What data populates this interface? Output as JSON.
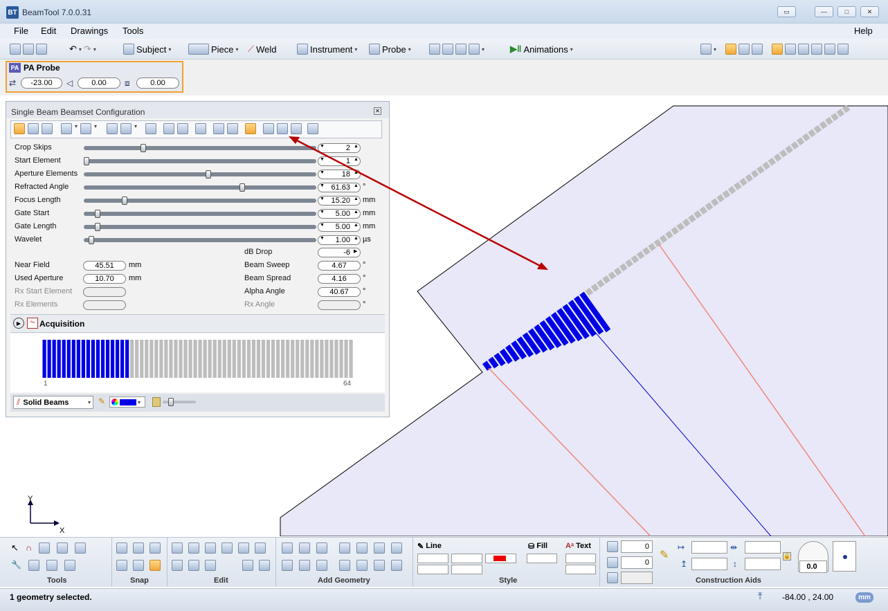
{
  "app": {
    "title": "BeamTool 7.0.0.31",
    "logo": "BT",
    "window_buttons": [
      "restore-icon",
      "minimize-icon",
      "maximize-icon",
      "close-icon"
    ]
  },
  "menu": {
    "file": "File",
    "edit": "Edit",
    "drawings": "Drawings",
    "tools": "Tools",
    "help": "Help"
  },
  "toolbar": {
    "subject": "Subject",
    "piece": "Piece",
    "weld": "Weld",
    "instrument": "Instrument",
    "probe": "Probe",
    "animations": "Animations"
  },
  "probe": {
    "badge": "PA",
    "name": "PA Probe",
    "fields": [
      {
        "icon": "offset-icon",
        "value": "-23.00"
      },
      {
        "icon": "skew-icon",
        "value": "0.00"
      },
      {
        "icon": "index-icon",
        "value": "0.00"
      }
    ]
  },
  "panel": {
    "title": "Single Beam Beamset Configuration",
    "sliders": [
      {
        "label": "Crop Skips",
        "value": "2",
        "unit": "",
        "pos": 0.25
      },
      {
        "label": "Start Element",
        "value": "1",
        "unit": "",
        "pos": 0.0
      },
      {
        "label": "Aperture Elements",
        "value": "18",
        "unit": "",
        "pos": 0.54
      },
      {
        "label": "Refracted Angle",
        "value": "61.63",
        "unit": "°",
        "pos": 0.69
      },
      {
        "label": "Focus Length",
        "value": "15.20",
        "unit": "mm",
        "pos": 0.17
      },
      {
        "label": "Gate Start",
        "value": "5.00",
        "unit": "mm",
        "pos": 0.05
      },
      {
        "label": "Gate Length",
        "value": "5.00",
        "unit": "mm",
        "pos": 0.05
      },
      {
        "label": "Wavelet",
        "value": "1.00",
        "unit": "µs",
        "pos": 0.02
      }
    ],
    "db_drop": {
      "label": "dB Drop",
      "value": "-6"
    },
    "left_readouts": [
      {
        "label": "Near Field",
        "value": "45.51",
        "unit": "mm",
        "disabled": false
      },
      {
        "label": "Used Aperture",
        "value": "10.70",
        "unit": "mm",
        "disabled": false
      },
      {
        "label": "Rx Start Element",
        "value": "",
        "unit": "",
        "disabled": true
      },
      {
        "label": "Rx Elements",
        "value": "",
        "unit": "",
        "disabled": true
      }
    ],
    "right_readouts": [
      {
        "label": "Beam Sweep",
        "value": "4.67",
        "unit": "°",
        "disabled": false
      },
      {
        "label": "Beam Spread",
        "value": "4.16",
        "unit": "°",
        "disabled": false
      },
      {
        "label": "Alpha Angle",
        "value": "40.67",
        "unit": "°",
        "disabled": false
      },
      {
        "label": "Rx Angle",
        "value": "",
        "unit": "°",
        "disabled": true
      }
    ],
    "acquisition": "Acquisition",
    "elements": {
      "total": 64,
      "active": 18,
      "first_label": "1",
      "last_label": "64",
      "active_color": "#0000e6",
      "inactive_color": "#bdbdbd"
    },
    "beam_style": "Solid Beams"
  },
  "ribbon": {
    "groups": [
      "Tools",
      "Snap",
      "Edit",
      "Add Geometry",
      "Style",
      "Construction Aids"
    ],
    "line": "Line",
    "fill": "Fill",
    "text": "Text",
    "aid_values": [
      "0",
      "0"
    ],
    "angle": "0.0"
  },
  "status": {
    "message": "1 geometry selected.",
    "coords": "-84.00 , 24.00",
    "unit": "mm"
  },
  "axes": {
    "x": "X",
    "y": "Y"
  },
  "colors": {
    "accent": "#f0a030",
    "beam": "#0000e6",
    "piece_fill": "#e8e8f8",
    "arrow": "#b80000"
  }
}
